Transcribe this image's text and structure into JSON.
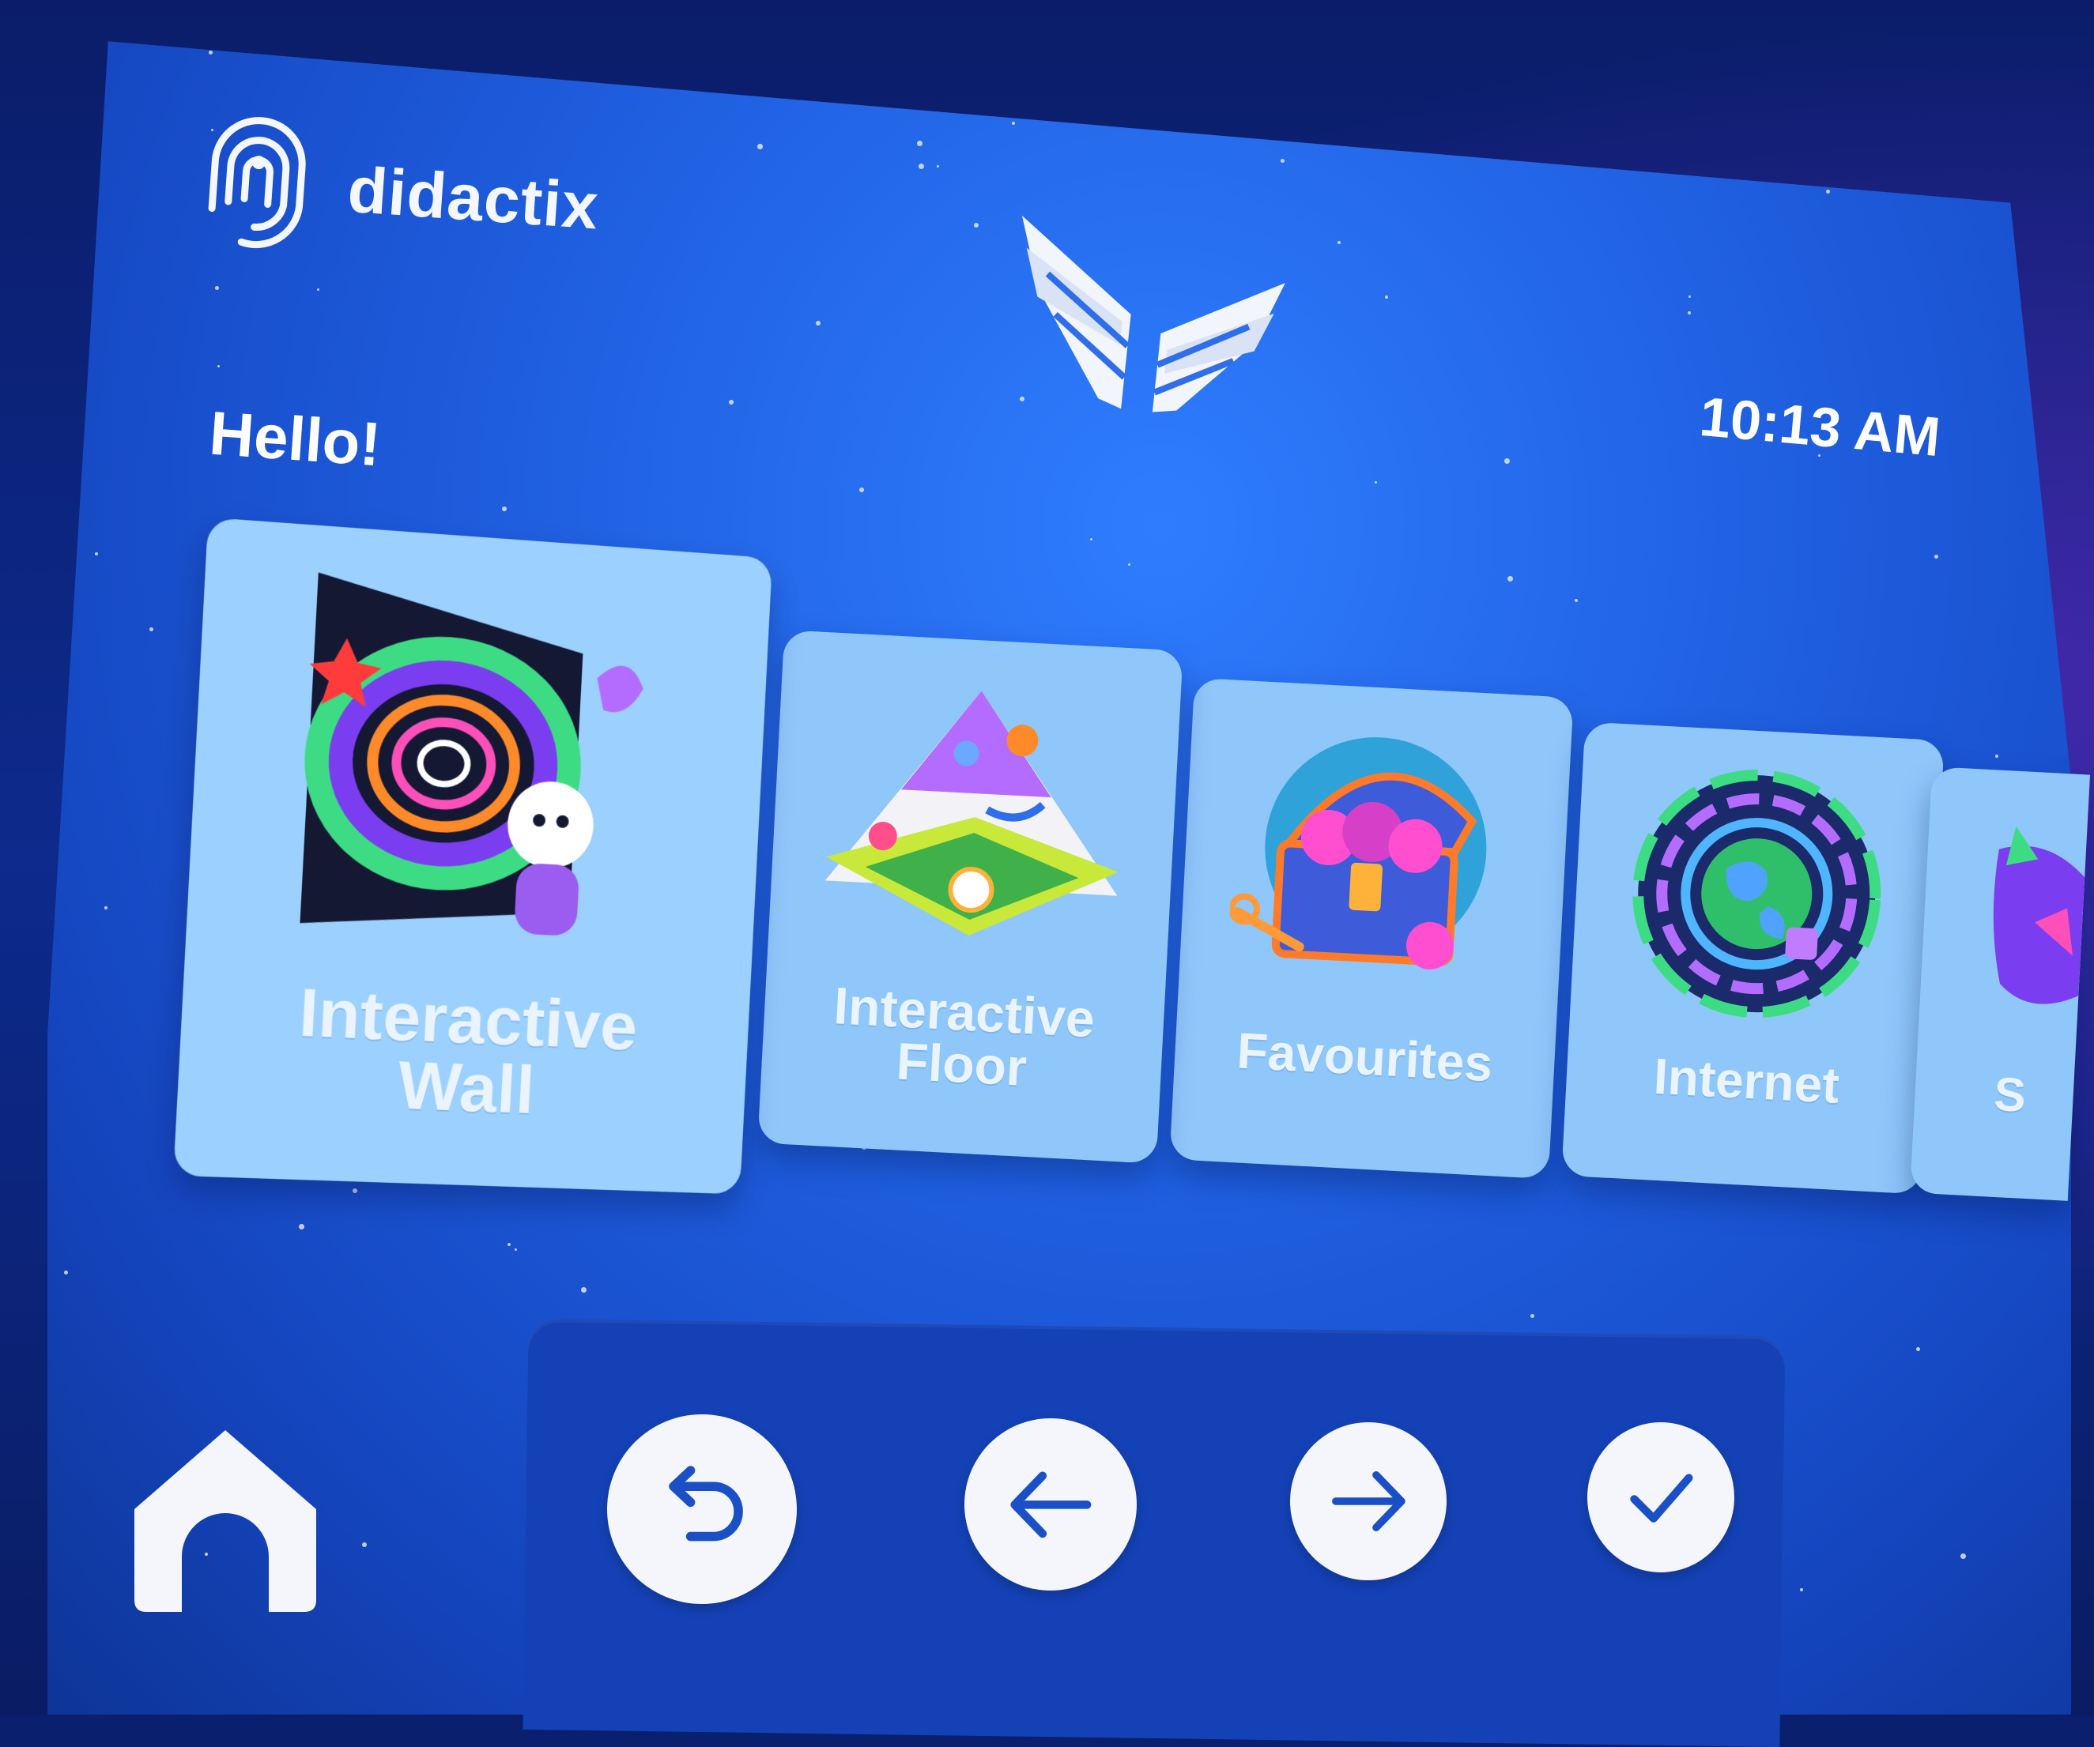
{
  "brand": {
    "name": "didactix"
  },
  "header": {
    "greeting": "Hello!",
    "time": "10:13 AM"
  },
  "tiles": [
    {
      "label_line1": "Interactive",
      "label_line2": "Wall",
      "icon": "galaxy-portal-icon"
    },
    {
      "label_line1": "Interactive",
      "label_line2": "Floor",
      "icon": "pyramid-maze-icon"
    },
    {
      "label_line1": "Favourites",
      "label_line2": "",
      "icon": "treasure-chest-icon"
    },
    {
      "label_line1": "Internet",
      "label_line2": "",
      "icon": "globe-portal-icon"
    },
    {
      "label_line1": "S",
      "label_line2": "",
      "icon": "partial-tile-icon"
    }
  ],
  "nav": {
    "home": "home-icon",
    "back": "undo-arrow-icon",
    "left": "arrow-left-icon",
    "right": "arrow-right-icon",
    "confirm": "checkmark-icon"
  },
  "colors": {
    "screen": "#1f5fe0",
    "tile": "#8fc7fb",
    "navbar": "#1442b6",
    "button": "#f4f6fb",
    "icon_stroke": "#1a4fc6"
  }
}
